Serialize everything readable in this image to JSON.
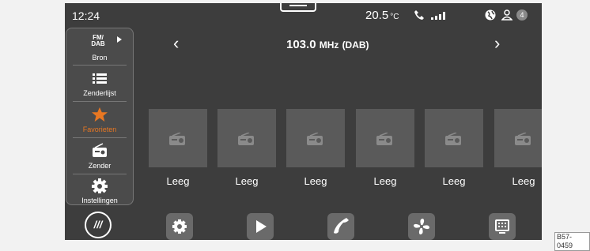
{
  "status": {
    "time": "12:24",
    "temperature": "20.5",
    "temperature_unit": "°C",
    "notification_count": "4"
  },
  "sidebar": {
    "items": [
      {
        "icon_text": "FM/ DAB",
        "label": "Bron",
        "icon": "fm-dab-icon"
      },
      {
        "label": "Zenderlijst",
        "icon": "list-icon"
      },
      {
        "label": "Favorieten",
        "icon": "star-icon",
        "active": true
      },
      {
        "label": "Zender",
        "icon": "radio-icon"
      },
      {
        "label": "Instellingen",
        "icon": "gear-icon"
      }
    ]
  },
  "station": {
    "frequency": "103.0",
    "unit": "MHz",
    "band": "(DAB)"
  },
  "presets": [
    {
      "label": "Leeg"
    },
    {
      "label": "Leeg"
    },
    {
      "label": "Leeg"
    },
    {
      "label": "Leeg"
    },
    {
      "label": "Leeg"
    },
    {
      "label": "Leeg"
    }
  ],
  "dock": {
    "home_label": "///",
    "buttons": [
      "settings-icon",
      "play-icon",
      "phone-icon",
      "fan-icon",
      "media-icon"
    ]
  },
  "figure_code": "B57-0459",
  "colors": {
    "screen_bg": "#3d3d3d",
    "accent": "#e87722",
    "tile_bg": "#5a5a5a"
  }
}
